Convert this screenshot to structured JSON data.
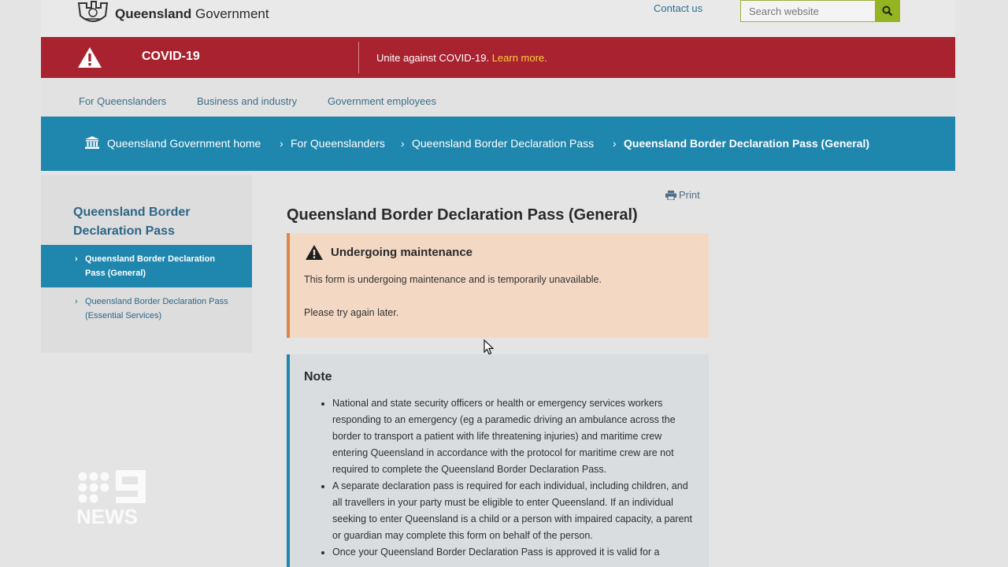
{
  "header": {
    "logo_bold": "Queensland",
    "logo_light": "Government",
    "contact_label": "Contact us",
    "search_placeholder": "Search website",
    "search_icon": "search-icon"
  },
  "covid_banner": {
    "title": "COVID-19",
    "message": "Unite against COVID-19. ",
    "link": "Learn more.",
    "colors": {
      "background": "#a8232f",
      "link": "#ffcf3a"
    }
  },
  "subnav": {
    "items": [
      "For Queenslanders",
      "Business and industry",
      "Government employees"
    ]
  },
  "breadcrumb": {
    "items": [
      "Queensland Government home",
      "For Queenslanders",
      "Queensland Border Declaration Pass",
      "Queensland Border Declaration Pass (General)"
    ],
    "color": "#1f86ad"
  },
  "sidebar": {
    "title": "Queensland Border Declaration Pass",
    "items": [
      {
        "label": "Queensland Border Declaration Pass (General)",
        "active": true
      },
      {
        "label": "Queensland Border Declaration Pass (Essential Services)",
        "active": false
      }
    ]
  },
  "main": {
    "print_label": "Print",
    "title": "Queensland Border Declaration Pass (General)",
    "alert": {
      "heading": "Undergoing maintenance",
      "line1": "This form is undergoing maintenance and is temporarily unavailable.",
      "line2": "Please try again later."
    },
    "note": {
      "heading": "Note",
      "items": [
        "National and state security officers or health or emergency services workers responding to an emergency (eg a paramedic driving an ambulance across the border to transport a patient with life threatening injuries) and maritime crew entering Queensland in accordance with the protocol for maritime crew are not required to complete the Queensland Border Declaration Pass.",
        "A separate declaration pass is required for each individual, including children, and all travellers in your party must be eligible to enter Queensland. If an individual seeking to enter Queensland is a child or a person with impaired capacity, a parent or guardian may complete this form on behalf of the person.",
        "Once your Queensland Border Declaration Pass is approved it is valid for a"
      ]
    }
  },
  "watermark": {
    "brand": "9NEWS"
  }
}
